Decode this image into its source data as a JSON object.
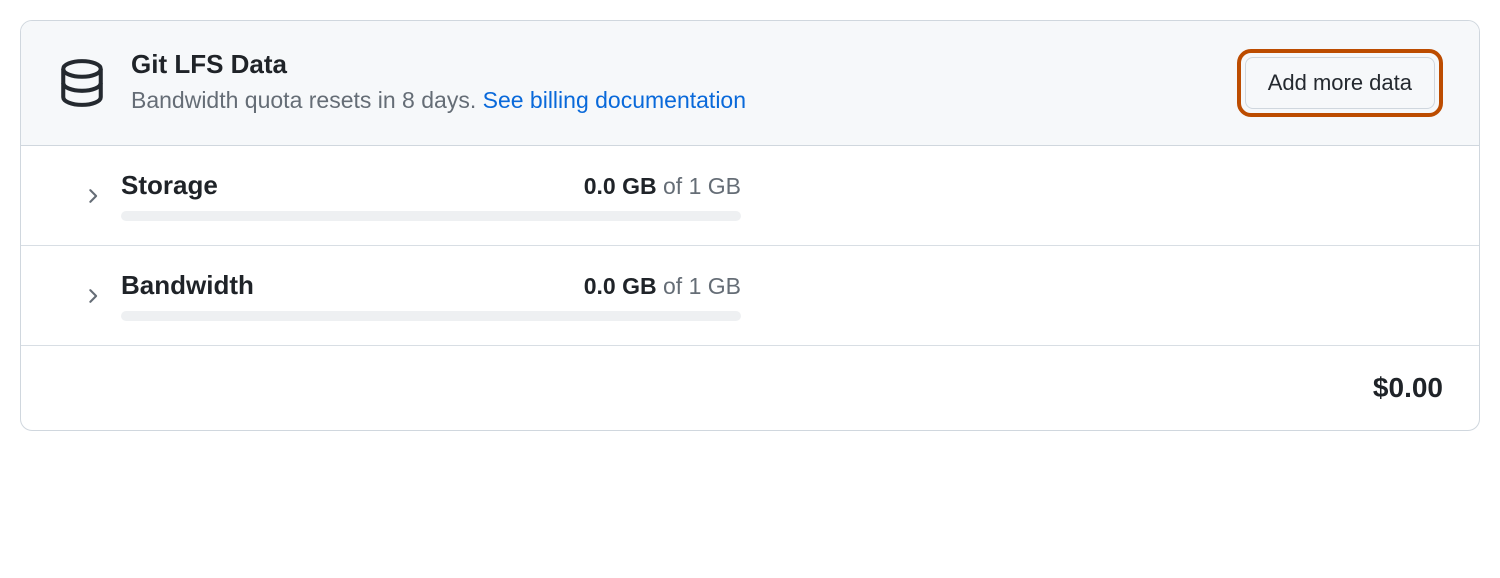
{
  "header": {
    "title": "Git LFS Data",
    "subtitle_text": "Bandwidth quota resets in 8 days. ",
    "doc_link_text": "See billing documentation",
    "action_label": "Add more data"
  },
  "usage": [
    {
      "label": "Storage",
      "used": "0.0 GB",
      "of_text": " of 1 GB"
    },
    {
      "label": "Bandwidth",
      "used": "0.0 GB",
      "of_text": " of 1 GB"
    }
  ],
  "footer": {
    "amount": "$0.00"
  }
}
